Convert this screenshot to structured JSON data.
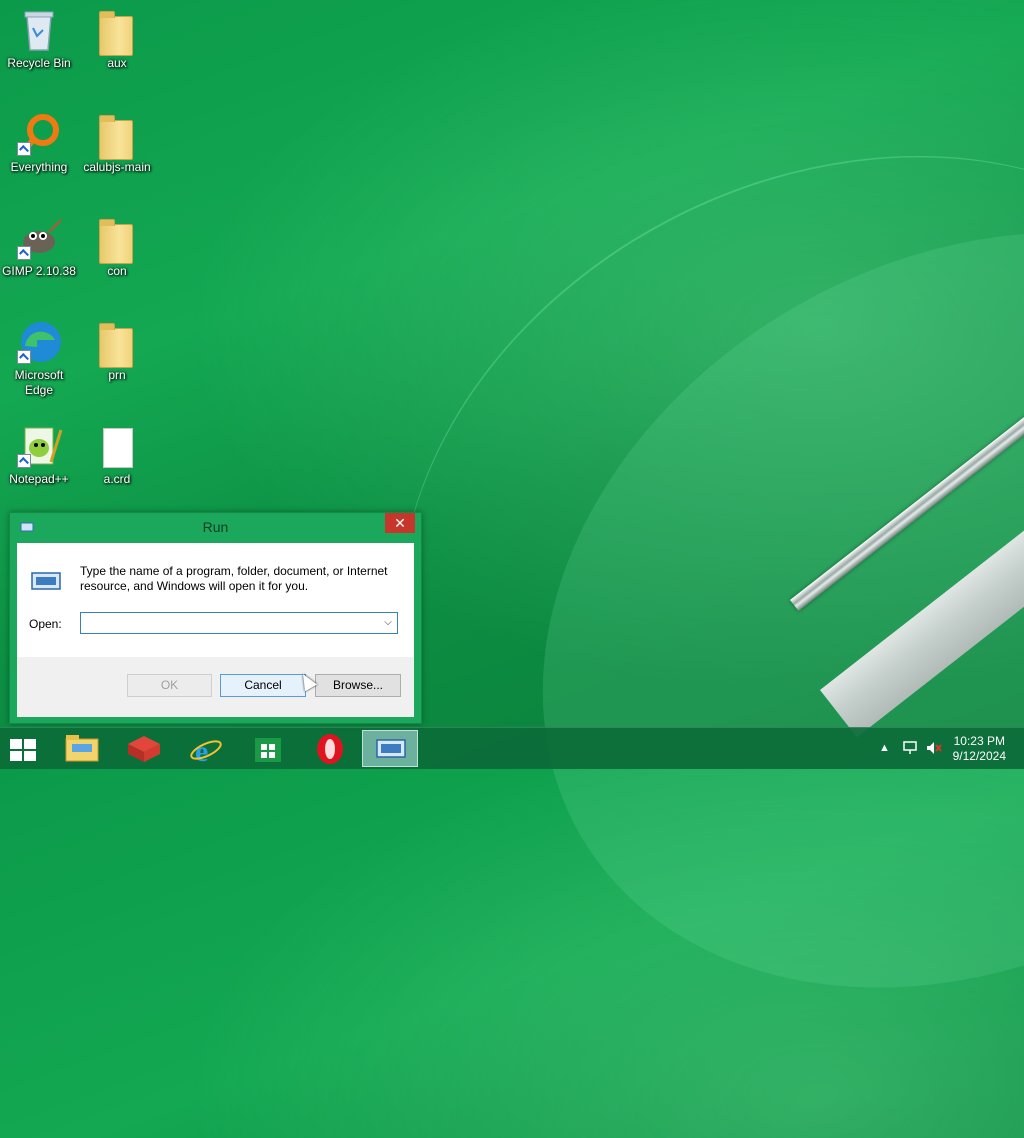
{
  "desktop": {
    "icons": [
      {
        "label": "Recycle Bin",
        "icon": "recycle-bin-icon"
      },
      {
        "label": "aux",
        "icon": "folder-icon"
      },
      {
        "label": "Everything",
        "icon": "everything-icon"
      },
      {
        "label": "calubjs-main",
        "icon": "folder-icon"
      },
      {
        "label": "GIMP 2.10.38",
        "icon": "gimp-icon"
      },
      {
        "label": "con",
        "icon": "folder-icon"
      },
      {
        "label": "Microsoft Edge",
        "icon": "edge-icon"
      },
      {
        "label": "prn",
        "icon": "folder-icon"
      },
      {
        "label": "Notepad++",
        "icon": "notepadpp-icon"
      },
      {
        "label": "a.crd",
        "icon": "file-icon"
      }
    ]
  },
  "run_dialog": {
    "title": "Run",
    "close_glyph": "✕",
    "description": "Type the name of a program, folder, document, or Internet resource, and Windows will open it for you.",
    "open_label": "Open:",
    "open_value": "",
    "ok_label": "OK",
    "cancel_label": "Cancel",
    "browse_label": "Browse..."
  },
  "taskbar": {
    "apps": [
      "start-button",
      "file-explorer",
      "app-red-box",
      "internet-explorer",
      "windows-store",
      "opera",
      "run"
    ],
    "clock_time": "10:23 PM",
    "clock_date": "9/12/2024",
    "tray_chevron": "▲"
  },
  "colors": {
    "desktop_green": "#14a852",
    "dialog_frame": "#1ca85c",
    "close_red": "#c7362b",
    "taskbar": "#0c6c3a"
  }
}
